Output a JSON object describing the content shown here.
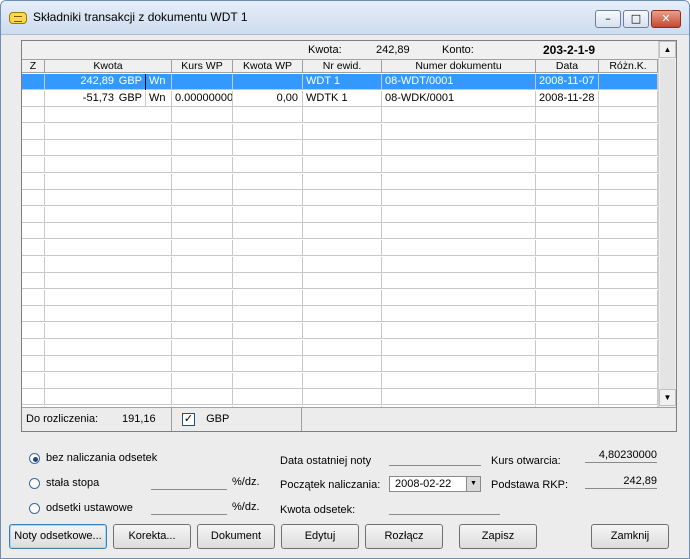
{
  "window": {
    "title": "Składniki transakcji z dokumentu WDT  1"
  },
  "summary": {
    "kwota_label": "Kwota:",
    "kwota_value": "242,89",
    "konto_label": "Konto:",
    "konto_value": "203-2-1-9"
  },
  "table": {
    "columns": [
      "Z",
      "Kwota",
      "Kurs WP",
      "Kwota WP",
      "Nr ewid.",
      "Numer dokumentu",
      "Data",
      "Różn.K."
    ],
    "rows": [
      {
        "z": "",
        "kwota": "242,89",
        "waluta": "GBP",
        "strona": "Wn",
        "kurs_wp": "",
        "kwota_wp": "",
        "nr_ewid": "WDT  1",
        "numer_dokumentu": "08-WDT/0001",
        "data": "2008-11-07",
        "rozn_k": "",
        "selected": true
      },
      {
        "z": "",
        "kwota": "-51,73",
        "waluta": "GBP",
        "strona": "Wn",
        "kurs_wp": "0.00000000",
        "kwota_wp": "0,00",
        "nr_ewid": "WDTK  1",
        "numer_dokumentu": "08-WDK/0001",
        "data": "2008-11-28",
        "rozn_k": "",
        "selected": false
      }
    ]
  },
  "footer": {
    "do_rozliczenia_label": "Do rozliczenia:",
    "do_rozliczenia_value": "191,16",
    "currency_checkbox_checked": true,
    "currency": "GBP"
  },
  "options": {
    "radio_no_interest": "bez naliczania odsetek",
    "radio_fixed_rate": "stała stopa",
    "radio_statutory": "odsetki ustawowe",
    "selected_radio": "radio_no_interest",
    "percent_unit": "%/dz.",
    "fixed_rate_value": "",
    "statutory_value": "",
    "last_note_date_label": "Data ostatniej noty",
    "last_note_date_value": "",
    "start_date_label": "Początek naliczania:",
    "start_date_value": "2008-02-22",
    "interest_amount_label": "Kwota odsetek:",
    "interest_amount_value": "",
    "opening_rate_label": "Kurs otwarcia:",
    "opening_rate_value": "4,80230000",
    "rkp_basis_label": "Podstawa RKP:",
    "rkp_basis_value": "242,89"
  },
  "buttons": {
    "noty": "Noty odsetkowe...",
    "korekta": "Korekta...",
    "dokument": "Dokument",
    "edytuj": "Edytuj",
    "rozlacz": "Rozłącz",
    "zapisz": "Zapisz",
    "zamknij": "Zamknij"
  }
}
